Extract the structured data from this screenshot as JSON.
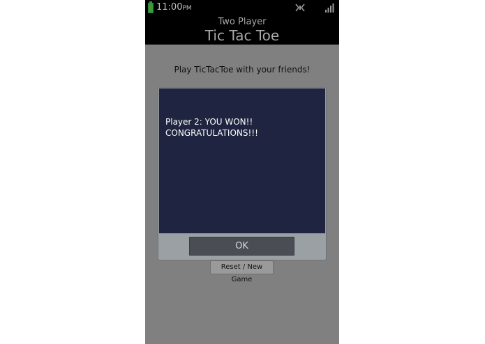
{
  "status_bar": {
    "time": "11:00",
    "ampm": "PM",
    "icons": [
      "battery-icon",
      "wifi-icon",
      "signal-icon"
    ],
    "battery_color": "#3b9a3b"
  },
  "header": {
    "subtitle": "Two Player",
    "title": "Tic Tac Toe"
  },
  "main": {
    "intro_text": "Play TicTacToe with your friends!",
    "reset_label": "Reset / New Game"
  },
  "dialog": {
    "message": "Player 2: YOU WON!!\nCONGRATULATIONS!!!",
    "ok_label": "OK",
    "background_color": "#1f2541"
  }
}
